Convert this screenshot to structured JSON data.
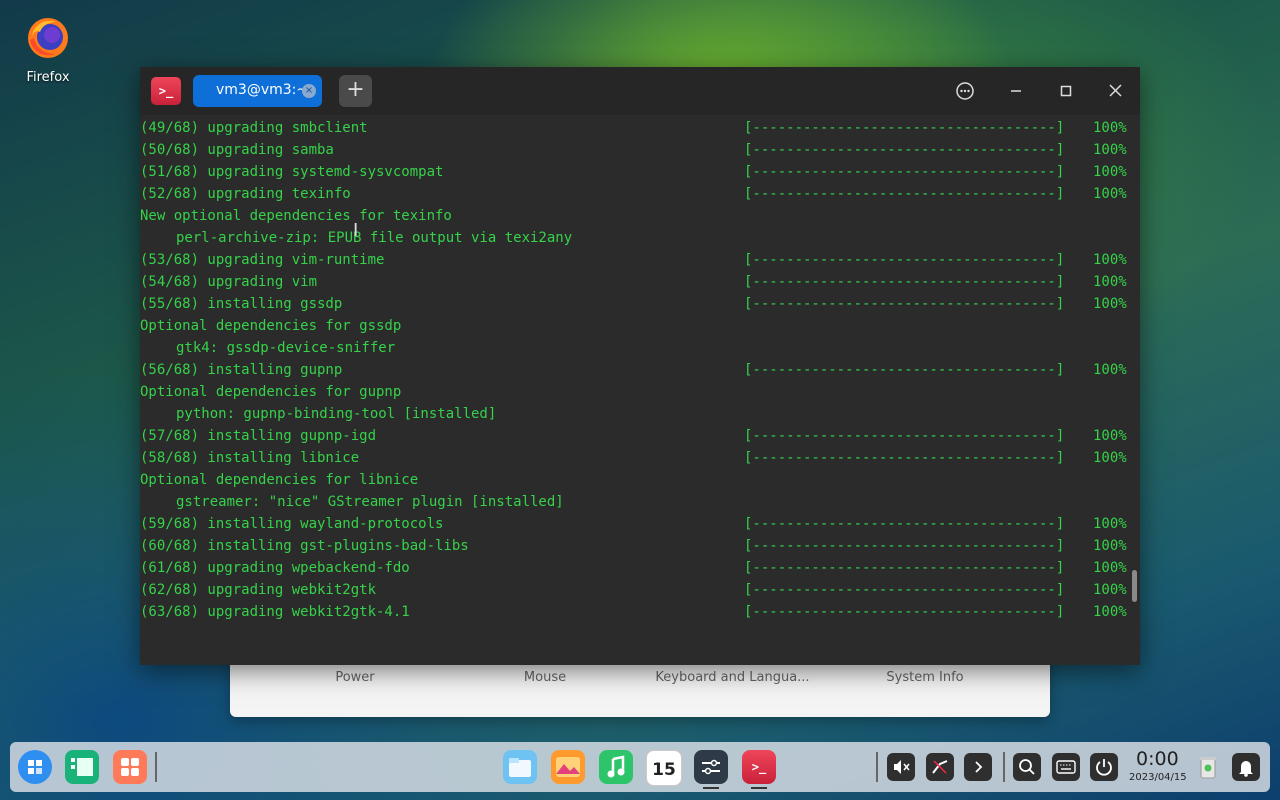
{
  "desktop": {
    "firefox_label": "Firefox"
  },
  "settings": {
    "tabs": [
      "Power",
      "Mouse",
      "Keyboard and Langua...",
      "System Info"
    ]
  },
  "terminal": {
    "app_icon_glyph": ">_",
    "tab_title": "vm3@vm3:~",
    "tab_close": "×",
    "new_tab": "+",
    "bar": "[------------------------------------]",
    "lines": [
      {
        "text": "(49/68) upgrading smbclient",
        "pct": "100%"
      },
      {
        "text": "(50/68) upgrading samba",
        "pct": "100%"
      },
      {
        "text": "(51/68) upgrading systemd-sysvcompat",
        "pct": "100%"
      },
      {
        "text": "(52/68) upgrading texinfo",
        "pct": "100%"
      },
      {
        "text": "New optional dependencies for texinfo"
      },
      {
        "text": "perl-archive-zip: EPUB file output via texi2any",
        "indent": true
      },
      {
        "text": "(53/68) upgrading vim-runtime",
        "pct": "100%"
      },
      {
        "text": "(54/68) upgrading vim",
        "pct": "100%"
      },
      {
        "text": "(55/68) installing gssdp",
        "pct": "100%"
      },
      {
        "text": "Optional dependencies for gssdp"
      },
      {
        "text": "gtk4: gssdp-device-sniffer",
        "indent": true
      },
      {
        "text": "(56/68) installing gupnp",
        "pct": "100%"
      },
      {
        "text": "Optional dependencies for gupnp"
      },
      {
        "text": "python: gupnp-binding-tool [installed]",
        "indent": true
      },
      {
        "text": "(57/68) installing gupnp-igd",
        "pct": "100%"
      },
      {
        "text": "(58/68) installing libnice",
        "pct": "100%"
      },
      {
        "text": "Optional dependencies for libnice"
      },
      {
        "text": "gstreamer: \"nice\" GStreamer plugin [installed]",
        "indent": true
      },
      {
        "text": "(59/68) installing wayland-protocols",
        "pct": "100%"
      },
      {
        "text": "(60/68) installing gst-plugins-bad-libs",
        "pct": "100%"
      },
      {
        "text": "(61/68) upgrading wpebackend-fdo",
        "pct": "100%"
      },
      {
        "text": "(62/68) upgrading webkit2gtk",
        "pct": "100%"
      },
      {
        "text": "(63/68) upgrading webkit2gtk-4.1",
        "pct": "100%"
      }
    ]
  },
  "dock": {
    "calendar_day": "15",
    "clock_time": "0:00",
    "clock_date": "2023/04/15"
  },
  "colors": {
    "terminal_text": "#35d24a",
    "accent": "#0f6fd8"
  }
}
